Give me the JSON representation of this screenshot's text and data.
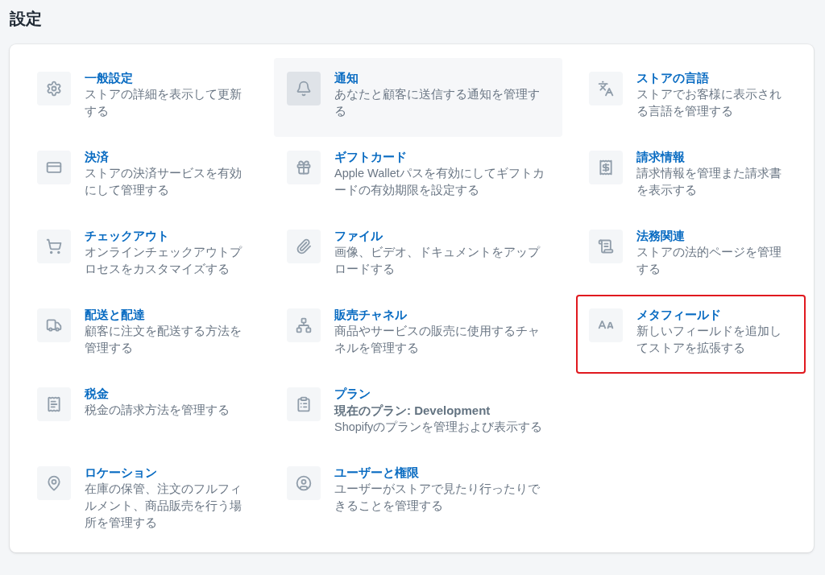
{
  "page": {
    "title": "設定"
  },
  "rows": [
    {
      "items": [
        {
          "title": "一般設定",
          "description": "ストアの詳細を表示して更新する",
          "hovered": false,
          "highlighted": false
        },
        {
          "title": "通知",
          "description": "あなたと顧客に送信する通知を管理する",
          "hovered": true,
          "highlighted": false
        },
        {
          "title": "ストアの言語",
          "description": "ストアでお客様に表示される言語を管理する",
          "hovered": false,
          "highlighted": false
        }
      ]
    },
    {
      "items": [
        {
          "title": "決済",
          "description": "ストアの決済サービスを有効にして管理する",
          "hovered": false,
          "highlighted": false
        },
        {
          "title": "ギフトカード",
          "description": "Apple Walletパスを有効にしてギフトカードの有効期限を設定する",
          "hovered": false,
          "highlighted": false
        },
        {
          "title": "請求情報",
          "description": "請求情報を管理また請求書を表示する",
          "hovered": false,
          "highlighted": false
        }
      ]
    },
    {
      "items": [
        {
          "title": "チェックアウト",
          "description": "オンラインチェックアウトプロセスをカスタマイズする",
          "hovered": false,
          "highlighted": false
        },
        {
          "title": "ファイル",
          "description": "画像、ビデオ、ドキュメントをアップロードする",
          "hovered": false,
          "highlighted": false
        },
        {
          "title": "法務関連",
          "description": "ストアの法的ページを管理する",
          "hovered": false,
          "highlighted": false
        }
      ]
    },
    {
      "items": [
        {
          "title": "配送と配達",
          "description": "顧客に注文を配送する方法を管理する",
          "hovered": false,
          "highlighted": false
        },
        {
          "title": "販売チャネル",
          "description": "商品やサービスの販売に使用するチャネルを管理する",
          "hovered": false,
          "highlighted": false
        },
        {
          "title": "メタフィールド",
          "description": "新しいフィールドを追加してストアを拡張する",
          "hovered": false,
          "highlighted": true
        }
      ]
    },
    {
      "items": [
        {
          "title": "税金",
          "description": "税金の請求方法を管理する",
          "hovered": false,
          "highlighted": false
        },
        {
          "title": "プラン",
          "detail": "現在のプラン: Development",
          "description": "Shopifyのプランを管理および表示する",
          "hovered": false,
          "highlighted": false
        }
      ]
    },
    {
      "items": [
        {
          "title": "ロケーション",
          "description": "在庫の保管、注文のフルフィルメント、商品販売を行う場所を管理する",
          "hovered": false,
          "highlighted": false
        },
        {
          "title": "ユーザーと権限",
          "description": "ユーザーがストアで見たり行ったりできることを管理する",
          "hovered": false,
          "highlighted": false
        }
      ]
    }
  ]
}
